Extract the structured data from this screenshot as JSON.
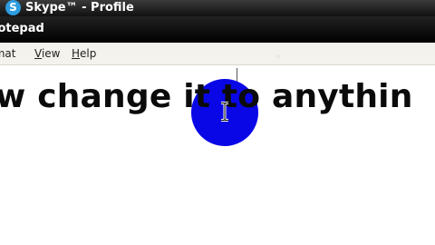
{
  "skype_window": {
    "title": "Skype™ - Profile",
    "logo_letter": "S"
  },
  "notepad_window": {
    "title": "lotepad"
  },
  "menubar": {
    "items": [
      {
        "label": "rmat"
      },
      {
        "label": "View"
      },
      {
        "label": "Help"
      }
    ]
  },
  "editor": {
    "text": "w change it to anythin"
  },
  "colors": {
    "highlight_circle": "#0a07e6",
    "skype_logo": "#2d9de0",
    "titlebar": "#111111",
    "menubar": "#f3f2ec"
  },
  "icons": {
    "skype_logo": "skype-logo-icon",
    "mouse_cursor": "ibeam-cursor-icon"
  }
}
